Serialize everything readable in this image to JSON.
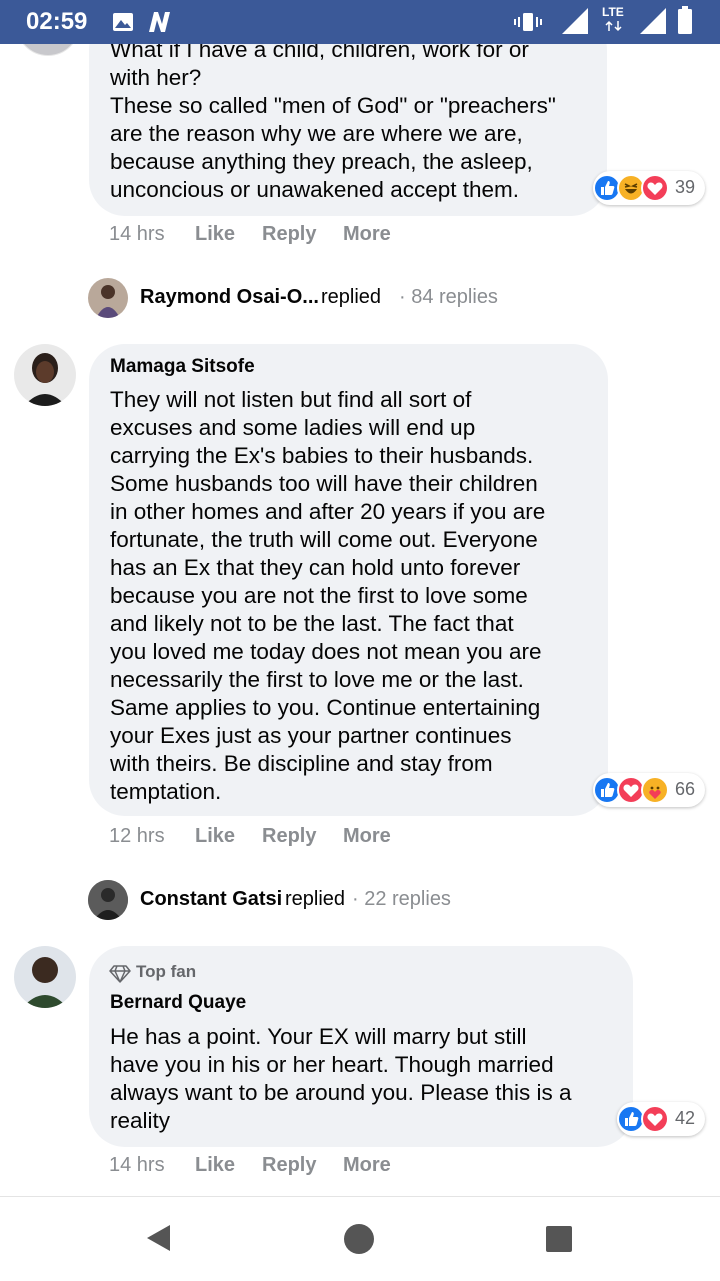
{
  "status_bar": {
    "time": "02:59",
    "network": "LTE",
    "icons": [
      "image-icon",
      "n-app-icon",
      "vibrate-icon",
      "signal-icon",
      "lte-icon",
      "signal-icon",
      "battery-icon"
    ]
  },
  "colors": {
    "status_bar_bg": "#3b5998",
    "bubble_bg": "#f0f2f5",
    "like": "#1877f2",
    "love": "#f33e58",
    "haha": "#f7b125",
    "meta_gray": "#8a8d91"
  },
  "comments": [
    {
      "text": "What if I have a child, children, work for or\nwith her?\nThese so called \"men of God\" or \"preachers\"\nare the reason why we are where we are,\nbecause anything they preach, the asleep,\nunconcious or unawakened accept them.",
      "reaction_count": "39",
      "reaction_icons": [
        "like-icon",
        "haha-icon",
        "love-icon"
      ],
      "time": "14 hrs",
      "like": "Like",
      "reply": "Reply",
      "more": "More"
    },
    {
      "author": "Mamaga Sitsofe",
      "text": "They will not listen but find all sort of\nexcuses and some ladies will end up\ncarrying the Ex's babies to their husbands.\nSome husbands too will have their children\nin other homes and after 20 years if you are\nfortunate, the truth will come out. Everyone\nhas an Ex that they can hold unto forever\nbecause you are not the first to love some\nand likely not to be the last. The fact that\nyou loved me today does not mean you are\nnecessarily the first to love me or the last.\nSame applies to you. Continue entertaining\nyour Exes just as your partner continues\nwith theirs. Be discipline and stay from\ntemptation.",
      "reaction_count": "66",
      "reaction_icons": [
        "like-icon",
        "love-icon",
        "care-icon"
      ],
      "time": "12 hrs",
      "like": "Like",
      "reply": "Reply",
      "more": "More"
    },
    {
      "badge": "Top fan",
      "author": "Bernard Quaye",
      "text": "He has a point. Your EX will marry but still\nhave you in his or her heart. Though married\nalways want to be around you. Please this is a\nreality",
      "reaction_count": "42",
      "reaction_icons": [
        "like-icon",
        "love-icon"
      ],
      "time": "14 hrs",
      "like": "Like",
      "reply": "Reply",
      "more": "More"
    }
  ],
  "replies": [
    {
      "name": "Raymond Osai-O...",
      "action": "replied",
      "count": "· 84 replies"
    },
    {
      "name": "Constant Gatsi",
      "action": "replied",
      "count": "· 22 replies"
    }
  ],
  "nav_bar": {
    "icons": [
      "back-icon",
      "home-icon",
      "recents-icon"
    ]
  }
}
